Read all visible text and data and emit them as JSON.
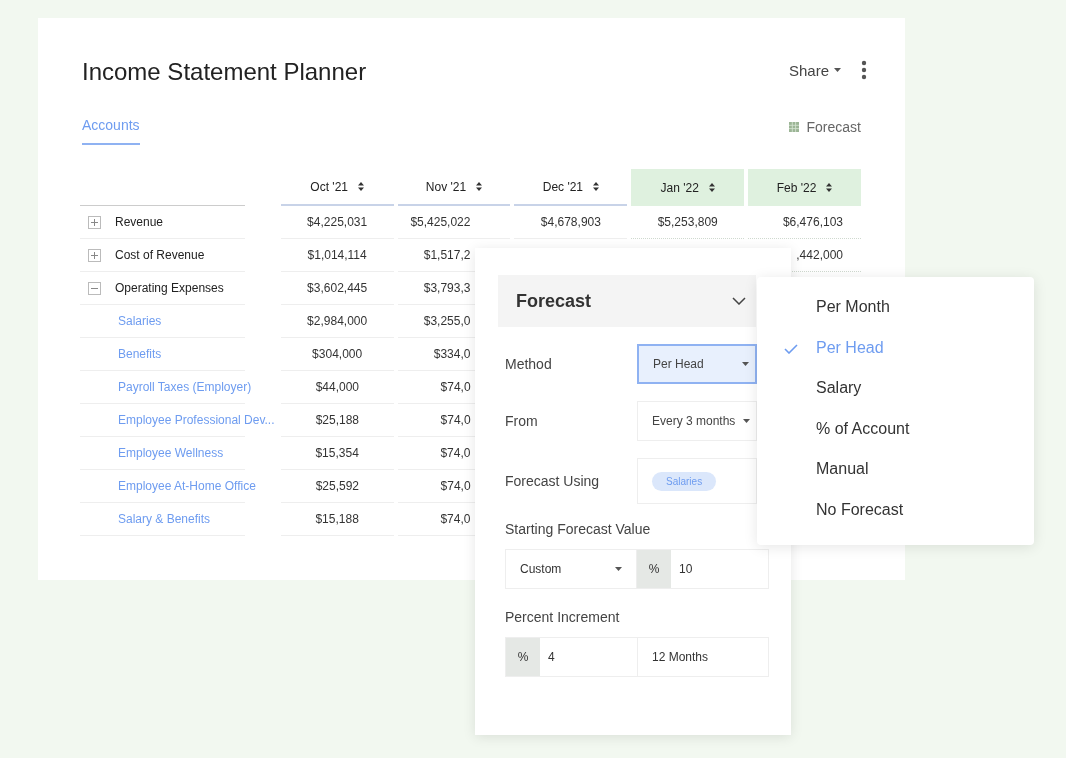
{
  "title": "Income Statement Planner",
  "share": {
    "label": "Share"
  },
  "tabs": [
    {
      "label": "Accounts",
      "selected": true
    }
  ],
  "legend": {
    "label": "Forecast"
  },
  "columns": [
    {
      "label": "Oct '21",
      "forecast": false
    },
    {
      "label": "Nov '21",
      "forecast": false
    },
    {
      "label": "Dec '21",
      "forecast": false
    },
    {
      "label": "Jan '22",
      "forecast": true
    },
    {
      "label": "Feb '22",
      "forecast": true
    }
  ],
  "rows": [
    {
      "kind": "group",
      "name": "Revenue",
      "expanded": false,
      "values": [
        "$4,225,031",
        "$5,425,022",
        "$4,678,903",
        "$5,253,809",
        "$6,476,103"
      ]
    },
    {
      "kind": "group",
      "name": "Cost of Revenue",
      "expanded": false,
      "values": [
        "$1,014,114",
        "$1,517,2"
      ],
      "trailing_values": [
        ",442,000"
      ]
    },
    {
      "kind": "group",
      "name": "Operating Expenses",
      "expanded": true,
      "values": [
        "$3,602,445",
        "$3,793,3"
      ]
    },
    {
      "kind": "child",
      "name": "Salaries",
      "values": [
        "$2,984,000",
        "$3,255,0"
      ]
    },
    {
      "kind": "child",
      "name": "Benefits",
      "values": [
        "$304,000",
        "$334,0"
      ]
    },
    {
      "kind": "child",
      "name": "Payroll Taxes (Employer)",
      "values": [
        "$44,000",
        "$74,0"
      ]
    },
    {
      "kind": "child",
      "name": "Employee Professional Dev...",
      "values": [
        "$25,188",
        "$74,0"
      ]
    },
    {
      "kind": "child",
      "name": "Employee Wellness",
      "values": [
        "$15,354",
        "$74,0"
      ]
    },
    {
      "kind": "child",
      "name": "Employee At-Home Office",
      "values": [
        "$25,592",
        "$74,0"
      ]
    },
    {
      "kind": "child",
      "name": "Salary & Benefits",
      "values": [
        "$15,188",
        "$74,0"
      ]
    }
  ],
  "forecast_panel": {
    "title": "Forecast",
    "method": {
      "label": "Method",
      "value": "Per Head",
      "focused": true
    },
    "from": {
      "label": "From",
      "value": "Every 3 months"
    },
    "using": {
      "label": "Forecast Using",
      "tag": "Salaries"
    },
    "starting": {
      "label": "Starting Forecast Value",
      "mode": "Custom",
      "unit": "%",
      "value": "10"
    },
    "increment": {
      "label": "Percent Increment",
      "unit": "%",
      "value": "4",
      "period": "12 Months"
    }
  },
  "method_menu": [
    {
      "label": "Per Month",
      "selected": false
    },
    {
      "label": "Per Head",
      "selected": true
    },
    {
      "label": "Salary",
      "selected": false
    },
    {
      "label": "% of Account",
      "selected": false
    },
    {
      "label": "Manual",
      "selected": false
    },
    {
      "label": "No Forecast",
      "selected": false
    }
  ]
}
